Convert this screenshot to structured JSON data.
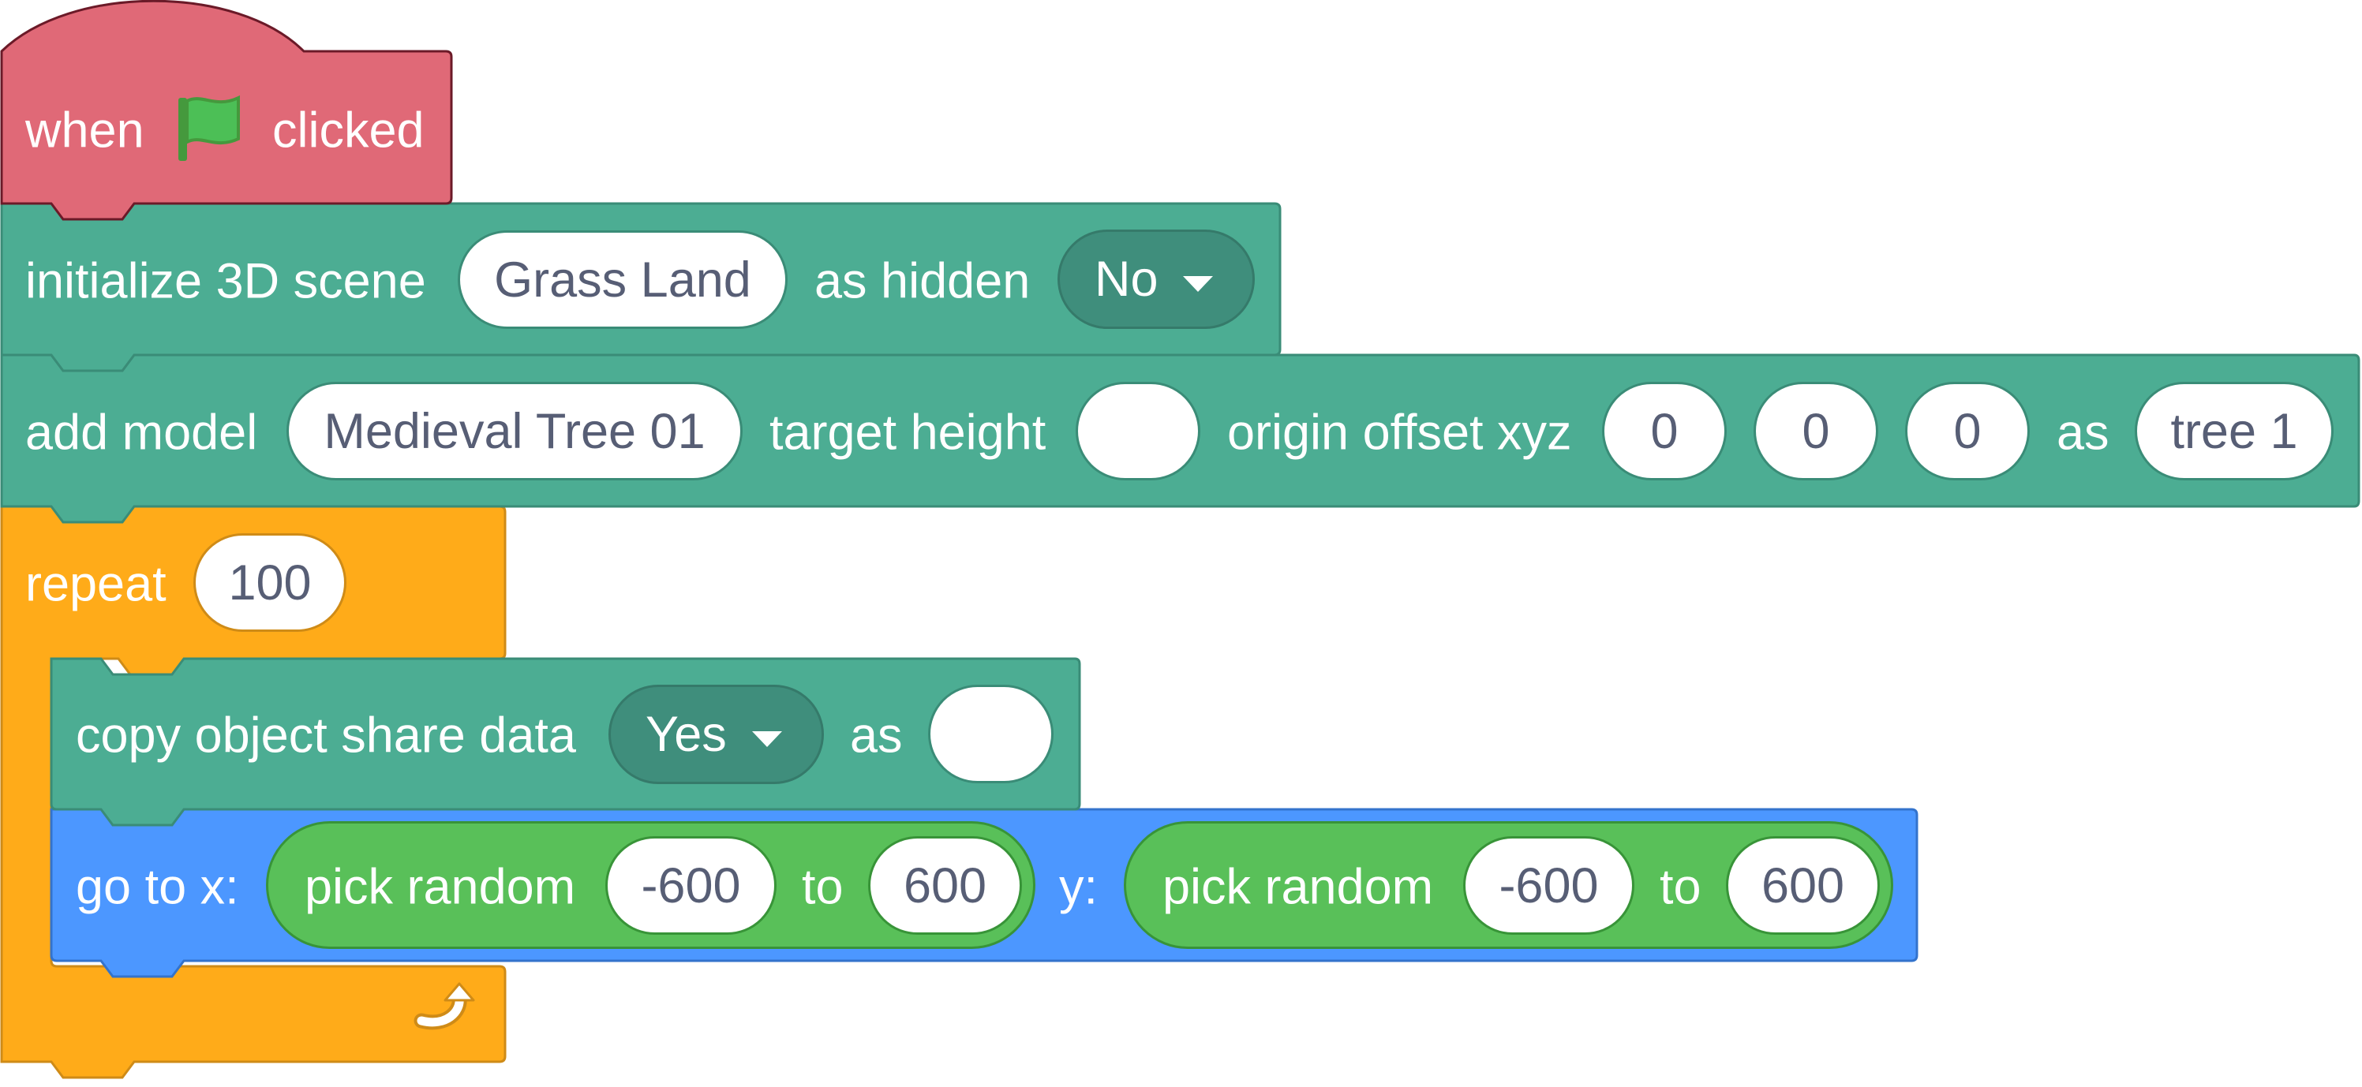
{
  "colors": {
    "event": "#e06977",
    "extension": "#4cad93",
    "control": "#ffab19",
    "motion": "#4c97ff",
    "operator": "#59c059"
  },
  "hat_block": {
    "word1": "when",
    "icon": "green-flag-icon",
    "word2": "clicked"
  },
  "init_scene": {
    "label": "initialize 3D scene",
    "scene_value": "Grass Land",
    "hidden_label": "as hidden",
    "hidden_value": "No"
  },
  "add_model": {
    "label": "add model",
    "model_value": "Medieval Tree 01",
    "height_label": "target height",
    "height_value": "",
    "offset_label": "origin offset xyz",
    "offset_x": "0",
    "offset_y": "0",
    "offset_z": "0",
    "as_label": "as",
    "name_value": "tree 1"
  },
  "repeat_block": {
    "label": "repeat",
    "count": "100",
    "loop_icon": "loop-arrow-icon"
  },
  "copy_object": {
    "label": "copy object share data",
    "share_value": "Yes",
    "as_label": "as",
    "name_value": ""
  },
  "goto": {
    "label_x": "go to x:",
    "label_y": "y:",
    "random_x": {
      "label": "pick random",
      "from": "-600",
      "to_label": "to",
      "to": "600"
    },
    "random_y": {
      "label": "pick random",
      "from": "-600",
      "to_label": "to",
      "to": "600"
    }
  }
}
